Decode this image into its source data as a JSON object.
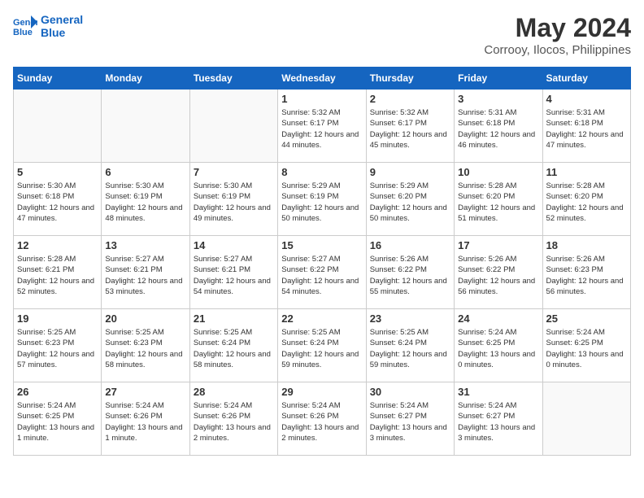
{
  "header": {
    "logo_line1": "General",
    "logo_line2": "Blue",
    "month_year": "May 2024",
    "location": "Corrooy, Ilocos, Philippines"
  },
  "weekdays": [
    "Sunday",
    "Monday",
    "Tuesday",
    "Wednesday",
    "Thursday",
    "Friday",
    "Saturday"
  ],
  "weeks": [
    [
      {
        "day": "",
        "info": ""
      },
      {
        "day": "",
        "info": ""
      },
      {
        "day": "",
        "info": ""
      },
      {
        "day": "1",
        "info": "Sunrise: 5:32 AM\nSunset: 6:17 PM\nDaylight: 12 hours\nand 44 minutes."
      },
      {
        "day": "2",
        "info": "Sunrise: 5:32 AM\nSunset: 6:17 PM\nDaylight: 12 hours\nand 45 minutes."
      },
      {
        "day": "3",
        "info": "Sunrise: 5:31 AM\nSunset: 6:18 PM\nDaylight: 12 hours\nand 46 minutes."
      },
      {
        "day": "4",
        "info": "Sunrise: 5:31 AM\nSunset: 6:18 PM\nDaylight: 12 hours\nand 47 minutes."
      }
    ],
    [
      {
        "day": "5",
        "info": "Sunrise: 5:30 AM\nSunset: 6:18 PM\nDaylight: 12 hours\nand 47 minutes."
      },
      {
        "day": "6",
        "info": "Sunrise: 5:30 AM\nSunset: 6:19 PM\nDaylight: 12 hours\nand 48 minutes."
      },
      {
        "day": "7",
        "info": "Sunrise: 5:30 AM\nSunset: 6:19 PM\nDaylight: 12 hours\nand 49 minutes."
      },
      {
        "day": "8",
        "info": "Sunrise: 5:29 AM\nSunset: 6:19 PM\nDaylight: 12 hours\nand 50 minutes."
      },
      {
        "day": "9",
        "info": "Sunrise: 5:29 AM\nSunset: 6:20 PM\nDaylight: 12 hours\nand 50 minutes."
      },
      {
        "day": "10",
        "info": "Sunrise: 5:28 AM\nSunset: 6:20 PM\nDaylight: 12 hours\nand 51 minutes."
      },
      {
        "day": "11",
        "info": "Sunrise: 5:28 AM\nSunset: 6:20 PM\nDaylight: 12 hours\nand 52 minutes."
      }
    ],
    [
      {
        "day": "12",
        "info": "Sunrise: 5:28 AM\nSunset: 6:21 PM\nDaylight: 12 hours\nand 52 minutes."
      },
      {
        "day": "13",
        "info": "Sunrise: 5:27 AM\nSunset: 6:21 PM\nDaylight: 12 hours\nand 53 minutes."
      },
      {
        "day": "14",
        "info": "Sunrise: 5:27 AM\nSunset: 6:21 PM\nDaylight: 12 hours\nand 54 minutes."
      },
      {
        "day": "15",
        "info": "Sunrise: 5:27 AM\nSunset: 6:22 PM\nDaylight: 12 hours\nand 54 minutes."
      },
      {
        "day": "16",
        "info": "Sunrise: 5:26 AM\nSunset: 6:22 PM\nDaylight: 12 hours\nand 55 minutes."
      },
      {
        "day": "17",
        "info": "Sunrise: 5:26 AM\nSunset: 6:22 PM\nDaylight: 12 hours\nand 56 minutes."
      },
      {
        "day": "18",
        "info": "Sunrise: 5:26 AM\nSunset: 6:23 PM\nDaylight: 12 hours\nand 56 minutes."
      }
    ],
    [
      {
        "day": "19",
        "info": "Sunrise: 5:25 AM\nSunset: 6:23 PM\nDaylight: 12 hours\nand 57 minutes."
      },
      {
        "day": "20",
        "info": "Sunrise: 5:25 AM\nSunset: 6:23 PM\nDaylight: 12 hours\nand 58 minutes."
      },
      {
        "day": "21",
        "info": "Sunrise: 5:25 AM\nSunset: 6:24 PM\nDaylight: 12 hours\nand 58 minutes."
      },
      {
        "day": "22",
        "info": "Sunrise: 5:25 AM\nSunset: 6:24 PM\nDaylight: 12 hours\nand 59 minutes."
      },
      {
        "day": "23",
        "info": "Sunrise: 5:25 AM\nSunset: 6:24 PM\nDaylight: 12 hours\nand 59 minutes."
      },
      {
        "day": "24",
        "info": "Sunrise: 5:24 AM\nSunset: 6:25 PM\nDaylight: 13 hours\nand 0 minutes."
      },
      {
        "day": "25",
        "info": "Sunrise: 5:24 AM\nSunset: 6:25 PM\nDaylight: 13 hours\nand 0 minutes."
      }
    ],
    [
      {
        "day": "26",
        "info": "Sunrise: 5:24 AM\nSunset: 6:25 PM\nDaylight: 13 hours\nand 1 minute."
      },
      {
        "day": "27",
        "info": "Sunrise: 5:24 AM\nSunset: 6:26 PM\nDaylight: 13 hours\nand 1 minute."
      },
      {
        "day": "28",
        "info": "Sunrise: 5:24 AM\nSunset: 6:26 PM\nDaylight: 13 hours\nand 2 minutes."
      },
      {
        "day": "29",
        "info": "Sunrise: 5:24 AM\nSunset: 6:26 PM\nDaylight: 13 hours\nand 2 minutes."
      },
      {
        "day": "30",
        "info": "Sunrise: 5:24 AM\nSunset: 6:27 PM\nDaylight: 13 hours\nand 3 minutes."
      },
      {
        "day": "31",
        "info": "Sunrise: 5:24 AM\nSunset: 6:27 PM\nDaylight: 13 hours\nand 3 minutes."
      },
      {
        "day": "",
        "info": ""
      }
    ]
  ]
}
